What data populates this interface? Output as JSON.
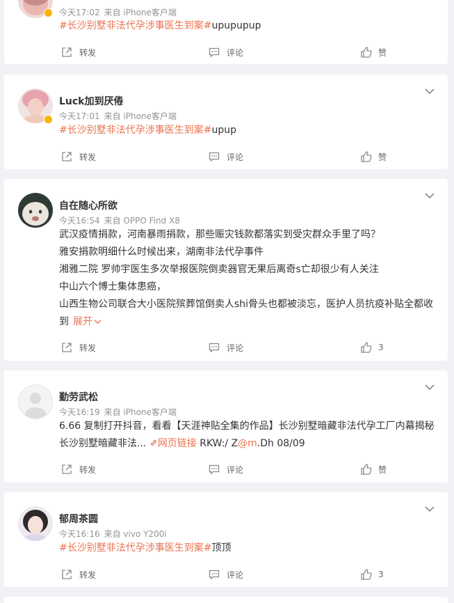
{
  "posts": [
    {
      "username": "",
      "time": "今天17:02",
      "source": "来自 iPhone客户端",
      "topic": "#长沙别墅非法代孕涉事医生到案#",
      "text_suffix": "upupupup",
      "actions": {
        "repost": "转发",
        "comment": "评论",
        "like": "赞"
      }
    },
    {
      "username": "Luck加到厌倦",
      "time": "今天17:01",
      "source": "来自 iPhone客户端",
      "topic": "#长沙别墅非法代孕涉事医生到案#",
      "text_suffix": "upup",
      "actions": {
        "repost": "转发",
        "comment": "评论",
        "like": "赞"
      }
    },
    {
      "username": "自在随心所欲",
      "time": "今天16:54",
      "source": "来自 OPPO Find X8",
      "lines": [
        "武汉疫情捐款，河南暴雨捐款，那些赈灾钱款都落实到受灾群众手里了吗？",
        "雅安捐款明细什么时候出来，湖南非法代孕事件",
        "湘雅二院 罗帅宇医生多次举报医院倒卖器官无果后离奇s亡却很少有人关注",
        "中山六个博士集体患癌，",
        "山西生物公司联合大小医院殡葬馆倒卖人shi骨头也都被淡忘，医护人员抗疫补贴全都收",
        "到"
      ],
      "expand": "展开",
      "actions": {
        "repost": "转发",
        "comment": "评论",
        "like": "3"
      }
    },
    {
      "username": "勤劳武松",
      "time": "今天16:19",
      "source": "来自 iPhone客户端",
      "line1": "6.66 复制打开抖音，看看【天涯神贴全集的作品】长沙别墅暗藏非法代孕工厂内幕揭秘",
      "line2_prefix": "长沙别墅暗藏非法...",
      "link_text": "网页链接",
      "line2_code_a": "RKW:/ Z",
      "line2_mention": "@m",
      "line2_code_b": ".Dh 08/09",
      "actions": {
        "repost": "转发",
        "comment": "评论",
        "like": "赞"
      }
    },
    {
      "username": "郁周茶圆",
      "time": "今天16:16",
      "source": "来自 vivo Y200i",
      "topic": "#长沙别墅非法代孕涉事医生到案#",
      "text_suffix": "顶顶",
      "actions": {
        "repost": "转发",
        "comment": "评论",
        "like": "3"
      }
    }
  ]
}
